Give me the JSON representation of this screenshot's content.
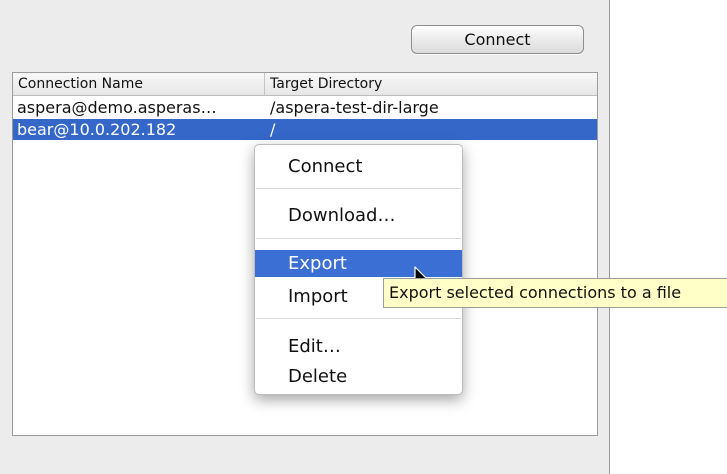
{
  "toolbar": {
    "connect_label": "Connect"
  },
  "table": {
    "columns": [
      "Connection Name",
      "Target Directory"
    ],
    "rows": [
      {
        "name": "aspera@demo.asperas…",
        "directory": "/aspera-test-dir-large",
        "selected": false
      },
      {
        "name": "bear@10.0.202.182",
        "directory": "/",
        "selected": true
      }
    ]
  },
  "context_menu": {
    "items": [
      "Connect",
      "Download…",
      "Export",
      "Import",
      "Edit…",
      "Delete"
    ],
    "highlighted": "Export"
  },
  "tooltip": {
    "text": "Export selected connections to a file"
  },
  "colors": {
    "selection": "#3467c8",
    "menu_highlight": "#3b6fd3",
    "tooltip_bg": "#ffffc7",
    "panel_bg": "#ececec"
  }
}
